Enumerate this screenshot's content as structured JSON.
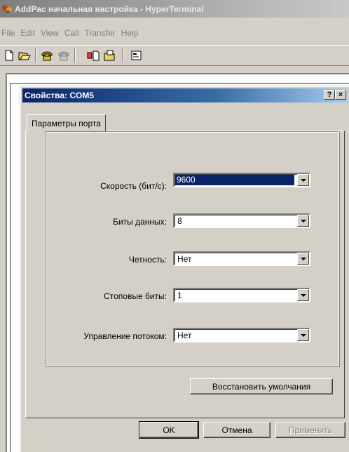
{
  "app": {
    "title": "AddPac начальная настройка - HyperTerminal",
    "menu": [
      "File",
      "Edit",
      "View",
      "Call",
      "Transfer",
      "Help"
    ]
  },
  "toolbar": {
    "buttons": [
      "new-icon",
      "open-icon",
      "connect-icon",
      "disconnect-icon",
      "send-icon",
      "receive-icon",
      "properties-icon"
    ]
  },
  "dialog": {
    "title": "Свойства: COM5",
    "help_label": "?",
    "close_label": "×",
    "tab_label": "Параметры порта",
    "fields": [
      {
        "label": "Скорость (бит/с):",
        "value": "9600"
      },
      {
        "label": "Биты данных:",
        "value": "8"
      },
      {
        "label": "Четность:",
        "value": "Нет"
      },
      {
        "label": "Стоповые биты:",
        "value": "1"
      },
      {
        "label": "Управление потоком:",
        "value": "Нет"
      }
    ],
    "restore_label": "Восстановить умолчания",
    "ok_label": "OK",
    "cancel_label": "Отмена",
    "apply_label": "Применить"
  }
}
